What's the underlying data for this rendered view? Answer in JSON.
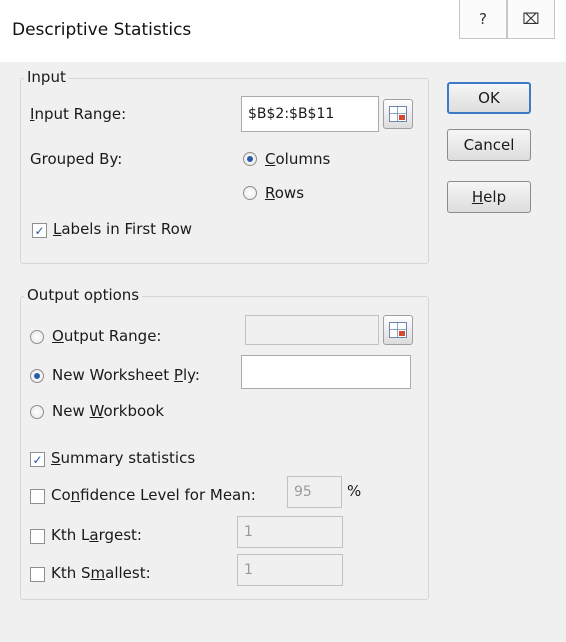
{
  "titlebar": {
    "title": "Descriptive Statistics",
    "help_glyph": "?",
    "close_glyph": "⌧"
  },
  "input_group": {
    "legend": "Input",
    "input_range_label": "Input Range:",
    "input_range_value": "$B$2:$B$11",
    "grouped_by_label": "Grouped By:",
    "columns_label": "Columns",
    "rows_label": "Rows",
    "grouped_by_selected": "Columns",
    "labels_first_row_label": "Labels in First Row",
    "labels_first_row_checked": true
  },
  "output_group": {
    "legend": "Output options",
    "output_range_label": "Output Range:",
    "output_range_value": "",
    "new_worksheet_label": "New Worksheet Ply:",
    "new_worksheet_value": "",
    "new_workbook_label": "New Workbook",
    "selected": "New Worksheet Ply",
    "summary_stats_label": "Summary statistics",
    "summary_stats_checked": true,
    "confidence_label": "Confidence Level for Mean:",
    "confidence_value": "95",
    "confidence_unit": "%",
    "kth_largest_label": "Kth Largest:",
    "kth_largest_value": "1",
    "kth_smallest_label": "Kth Smallest:",
    "kth_smallest_value": "1"
  },
  "buttons": {
    "ok": "OK",
    "cancel": "Cancel",
    "help": "Help"
  }
}
